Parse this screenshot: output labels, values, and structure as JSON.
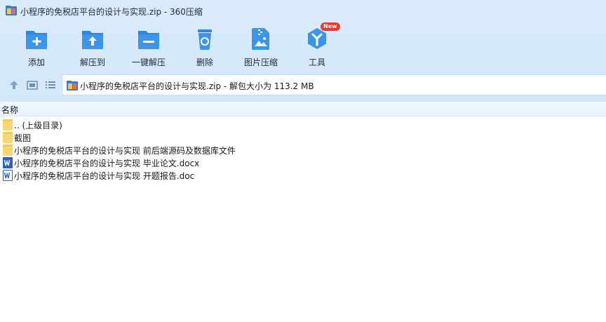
{
  "window": {
    "title": "小程序的免税店平台的设计与实现.zip - 360压缩"
  },
  "toolbar": {
    "items": [
      {
        "label": "添加",
        "icon": "add-icon"
      },
      {
        "label": "解压到",
        "icon": "extract-to-icon"
      },
      {
        "label": "一键解压",
        "icon": "one-click-extract-icon"
      },
      {
        "label": "删除",
        "icon": "delete-icon"
      },
      {
        "label": "图片压缩",
        "icon": "image-compress-icon"
      },
      {
        "label": "工具",
        "icon": "tools-icon",
        "badge": "New"
      }
    ]
  },
  "navbar": {
    "buttons": [
      "up-icon",
      "view-thumbnail-icon",
      "view-list-icon"
    ],
    "address": "小程序的免税店平台的设计与实现.zip - 解包大小为 113.2 MB"
  },
  "filelist": {
    "header": "名称",
    "rows": [
      {
        "name": ".. (上级目录)",
        "type": "folder"
      },
      {
        "name": "截图",
        "type": "folder"
      },
      {
        "name": "小程序的免税店平台的设计与实现 前后端源码及数据库文件",
        "type": "folder"
      },
      {
        "name": "小程序的免税店平台的设计与实现 毕业论文.docx",
        "type": "docx"
      },
      {
        "name": "小程序的免税店平台的设计与实现 开题报告.doc",
        "type": "doc"
      }
    ]
  },
  "colors": {
    "accent": "#2f86e0",
    "chrome_bg": "#d6e9fb",
    "folder": "#f7d774",
    "word_blue": "#2b5fc7",
    "badge": "#e8382f"
  }
}
